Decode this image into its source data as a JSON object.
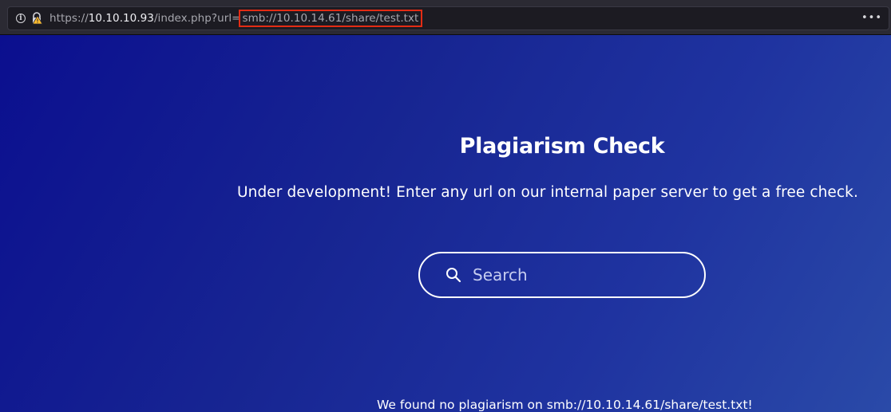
{
  "browser": {
    "url": {
      "scheme": "https://",
      "host": "10.10.10.93",
      "path": "/index.php?url=",
      "highlighted_param": "smb://10.10.14.61/share/test.txt"
    },
    "info_icon": "info-icon",
    "lock_icon": "insecure-lock-icon",
    "menu_icon": "more-icon",
    "highlight_color": "#e32c14"
  },
  "page": {
    "title": "Plagiarism Check",
    "subtitle": "Under development! Enter any url on our internal paper server to get a free check.",
    "search": {
      "placeholder": "Search",
      "value": ""
    },
    "result_text": "We found no plagiarism on smb://10.10.14.61/share/test.txt!"
  }
}
